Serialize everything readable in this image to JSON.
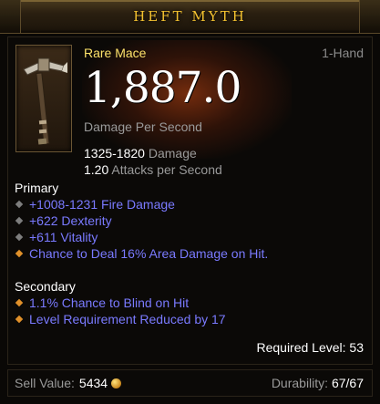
{
  "header": {
    "title": "HEFT MYTH"
  },
  "item": {
    "type": "Rare Mace",
    "slot": "1-Hand",
    "dps": "1,887.0",
    "dps_label": "Damage Per Second",
    "damage_value": "1325-1820",
    "damage_label": "Damage",
    "speed_value": "1.20",
    "speed_label": "Attacks per Second",
    "icon": "mace-icon"
  },
  "primary": {
    "title": "Primary",
    "affixes": [
      {
        "text": "+1008-1231 Fire Damage",
        "bullet": "grey-diamond"
      },
      {
        "text": "+622 Dexterity",
        "bullet": "grey-diamond"
      },
      {
        "text": "+611 Vitality",
        "bullet": "grey-diamond"
      },
      {
        "text": "Chance to Deal 16% Area Damage on Hit.",
        "bullet": "orange-diamond"
      }
    ]
  },
  "secondary": {
    "title": "Secondary",
    "affixes": [
      {
        "text": "1.1% Chance to Blind on Hit",
        "bullet": "orange-diamond"
      },
      {
        "text": "Level Requirement Reduced by 17",
        "bullet": "orange-diamond"
      }
    ]
  },
  "required_level": "Required Level: 53",
  "footer": {
    "sell_label": "Sell Value:",
    "sell_value": "5434",
    "durability_label": "Durability:",
    "durability_value": "67/67"
  },
  "colors": {
    "title": "#f4c230",
    "rare": "#fde26a",
    "magic_affix": "#7a7aff",
    "grey_text": "#9a9a9a"
  }
}
